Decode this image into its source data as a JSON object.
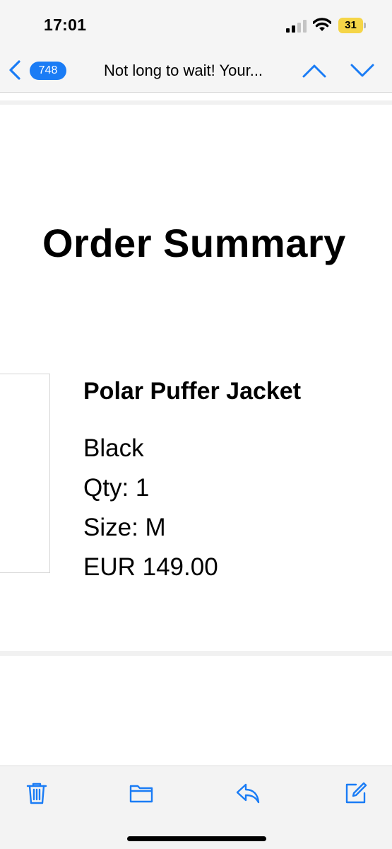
{
  "status_bar": {
    "time": "17:01",
    "battery_level": "31",
    "battery_color": "#f5d547"
  },
  "nav": {
    "unread_count": "748",
    "subject": "Not long to wait! Your...",
    "accent_color": "#1a7cf5",
    "icons": [
      "back-chevron-icon",
      "chevron-up-icon",
      "chevron-down-icon"
    ]
  },
  "email": {
    "heading": "Order Summary",
    "product": {
      "name": "Polar Puffer Jacket",
      "color": "Black",
      "qty": "Qty: 1",
      "size": "Size: M",
      "price": "EUR 149.00"
    }
  },
  "toolbar": {
    "icons": [
      "trash-icon",
      "folder-icon",
      "reply-icon",
      "compose-icon"
    ]
  }
}
